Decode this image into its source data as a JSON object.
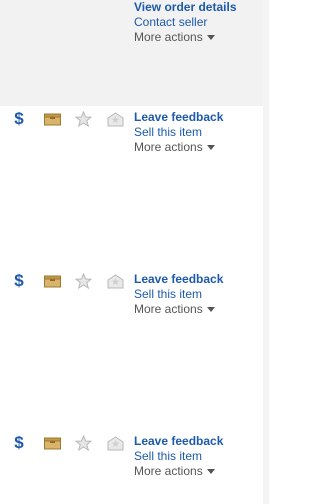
{
  "top": {
    "primary": "View order details",
    "secondary": "Contact seller",
    "more": "More actions"
  },
  "rows": [
    {
      "primary": "Leave feedback",
      "secondary": "Sell this item",
      "more": "More actions"
    },
    {
      "primary": "Leave feedback",
      "secondary": "Sell this item",
      "more": "More actions"
    },
    {
      "primary": "Leave feedback",
      "secondary": "Sell this item",
      "more": "More actions"
    }
  ],
  "icons": {
    "paid": "dollar-icon",
    "shipped": "package-icon",
    "feedback_left": "star-icon",
    "feedback_received": "envelope-star-icon",
    "paid_glyph": "$"
  },
  "colors": {
    "link": "#1e5aa9",
    "muted": "#555555",
    "package": "#c9a35a",
    "disabled_icon": "#c8c8c8",
    "top_bg": "#f2f2f2"
  }
}
